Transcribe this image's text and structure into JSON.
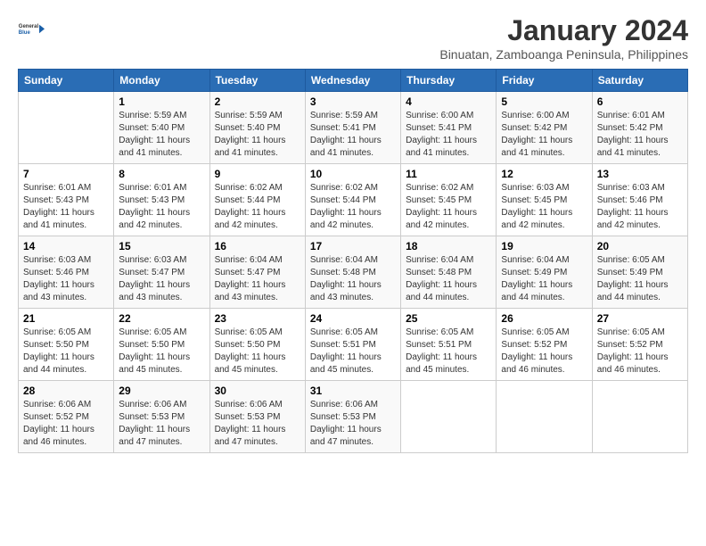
{
  "header": {
    "logo_line1": "General",
    "logo_line2": "Blue",
    "month": "January 2024",
    "location": "Binuatan, Zamboanga Peninsula, Philippines"
  },
  "weekdays": [
    "Sunday",
    "Monday",
    "Tuesday",
    "Wednesday",
    "Thursday",
    "Friday",
    "Saturday"
  ],
  "weeks": [
    [
      {
        "day": "",
        "sunrise": "",
        "sunset": "",
        "daylight": ""
      },
      {
        "day": "1",
        "sunrise": "Sunrise: 5:59 AM",
        "sunset": "Sunset: 5:40 PM",
        "daylight": "Daylight: 11 hours and 41 minutes."
      },
      {
        "day": "2",
        "sunrise": "Sunrise: 5:59 AM",
        "sunset": "Sunset: 5:40 PM",
        "daylight": "Daylight: 11 hours and 41 minutes."
      },
      {
        "day": "3",
        "sunrise": "Sunrise: 5:59 AM",
        "sunset": "Sunset: 5:41 PM",
        "daylight": "Daylight: 11 hours and 41 minutes."
      },
      {
        "day": "4",
        "sunrise": "Sunrise: 6:00 AM",
        "sunset": "Sunset: 5:41 PM",
        "daylight": "Daylight: 11 hours and 41 minutes."
      },
      {
        "day": "5",
        "sunrise": "Sunrise: 6:00 AM",
        "sunset": "Sunset: 5:42 PM",
        "daylight": "Daylight: 11 hours and 41 minutes."
      },
      {
        "day": "6",
        "sunrise": "Sunrise: 6:01 AM",
        "sunset": "Sunset: 5:42 PM",
        "daylight": "Daylight: 11 hours and 41 minutes."
      }
    ],
    [
      {
        "day": "7",
        "sunrise": "Sunrise: 6:01 AM",
        "sunset": "Sunset: 5:43 PM",
        "daylight": "Daylight: 11 hours and 41 minutes."
      },
      {
        "day": "8",
        "sunrise": "Sunrise: 6:01 AM",
        "sunset": "Sunset: 5:43 PM",
        "daylight": "Daylight: 11 hours and 42 minutes."
      },
      {
        "day": "9",
        "sunrise": "Sunrise: 6:02 AM",
        "sunset": "Sunset: 5:44 PM",
        "daylight": "Daylight: 11 hours and 42 minutes."
      },
      {
        "day": "10",
        "sunrise": "Sunrise: 6:02 AM",
        "sunset": "Sunset: 5:44 PM",
        "daylight": "Daylight: 11 hours and 42 minutes."
      },
      {
        "day": "11",
        "sunrise": "Sunrise: 6:02 AM",
        "sunset": "Sunset: 5:45 PM",
        "daylight": "Daylight: 11 hours and 42 minutes."
      },
      {
        "day": "12",
        "sunrise": "Sunrise: 6:03 AM",
        "sunset": "Sunset: 5:45 PM",
        "daylight": "Daylight: 11 hours and 42 minutes."
      },
      {
        "day": "13",
        "sunrise": "Sunrise: 6:03 AM",
        "sunset": "Sunset: 5:46 PM",
        "daylight": "Daylight: 11 hours and 42 minutes."
      }
    ],
    [
      {
        "day": "14",
        "sunrise": "Sunrise: 6:03 AM",
        "sunset": "Sunset: 5:46 PM",
        "daylight": "Daylight: 11 hours and 43 minutes."
      },
      {
        "day": "15",
        "sunrise": "Sunrise: 6:03 AM",
        "sunset": "Sunset: 5:47 PM",
        "daylight": "Daylight: 11 hours and 43 minutes."
      },
      {
        "day": "16",
        "sunrise": "Sunrise: 6:04 AM",
        "sunset": "Sunset: 5:47 PM",
        "daylight": "Daylight: 11 hours and 43 minutes."
      },
      {
        "day": "17",
        "sunrise": "Sunrise: 6:04 AM",
        "sunset": "Sunset: 5:48 PM",
        "daylight": "Daylight: 11 hours and 43 minutes."
      },
      {
        "day": "18",
        "sunrise": "Sunrise: 6:04 AM",
        "sunset": "Sunset: 5:48 PM",
        "daylight": "Daylight: 11 hours and 44 minutes."
      },
      {
        "day": "19",
        "sunrise": "Sunrise: 6:04 AM",
        "sunset": "Sunset: 5:49 PM",
        "daylight": "Daylight: 11 hours and 44 minutes."
      },
      {
        "day": "20",
        "sunrise": "Sunrise: 6:05 AM",
        "sunset": "Sunset: 5:49 PM",
        "daylight": "Daylight: 11 hours and 44 minutes."
      }
    ],
    [
      {
        "day": "21",
        "sunrise": "Sunrise: 6:05 AM",
        "sunset": "Sunset: 5:50 PM",
        "daylight": "Daylight: 11 hours and 44 minutes."
      },
      {
        "day": "22",
        "sunrise": "Sunrise: 6:05 AM",
        "sunset": "Sunset: 5:50 PM",
        "daylight": "Daylight: 11 hours and 45 minutes."
      },
      {
        "day": "23",
        "sunrise": "Sunrise: 6:05 AM",
        "sunset": "Sunset: 5:50 PM",
        "daylight": "Daylight: 11 hours and 45 minutes."
      },
      {
        "day": "24",
        "sunrise": "Sunrise: 6:05 AM",
        "sunset": "Sunset: 5:51 PM",
        "daylight": "Daylight: 11 hours and 45 minutes."
      },
      {
        "day": "25",
        "sunrise": "Sunrise: 6:05 AM",
        "sunset": "Sunset: 5:51 PM",
        "daylight": "Daylight: 11 hours and 45 minutes."
      },
      {
        "day": "26",
        "sunrise": "Sunrise: 6:05 AM",
        "sunset": "Sunset: 5:52 PM",
        "daylight": "Daylight: 11 hours and 46 minutes."
      },
      {
        "day": "27",
        "sunrise": "Sunrise: 6:05 AM",
        "sunset": "Sunset: 5:52 PM",
        "daylight": "Daylight: 11 hours and 46 minutes."
      }
    ],
    [
      {
        "day": "28",
        "sunrise": "Sunrise: 6:06 AM",
        "sunset": "Sunset: 5:52 PM",
        "daylight": "Daylight: 11 hours and 46 minutes."
      },
      {
        "day": "29",
        "sunrise": "Sunrise: 6:06 AM",
        "sunset": "Sunset: 5:53 PM",
        "daylight": "Daylight: 11 hours and 47 minutes."
      },
      {
        "day": "30",
        "sunrise": "Sunrise: 6:06 AM",
        "sunset": "Sunset: 5:53 PM",
        "daylight": "Daylight: 11 hours and 47 minutes."
      },
      {
        "day": "31",
        "sunrise": "Sunrise: 6:06 AM",
        "sunset": "Sunset: 5:53 PM",
        "daylight": "Daylight: 11 hours and 47 minutes."
      },
      {
        "day": "",
        "sunrise": "",
        "sunset": "",
        "daylight": ""
      },
      {
        "day": "",
        "sunrise": "",
        "sunset": "",
        "daylight": ""
      },
      {
        "day": "",
        "sunrise": "",
        "sunset": "",
        "daylight": ""
      }
    ]
  ]
}
